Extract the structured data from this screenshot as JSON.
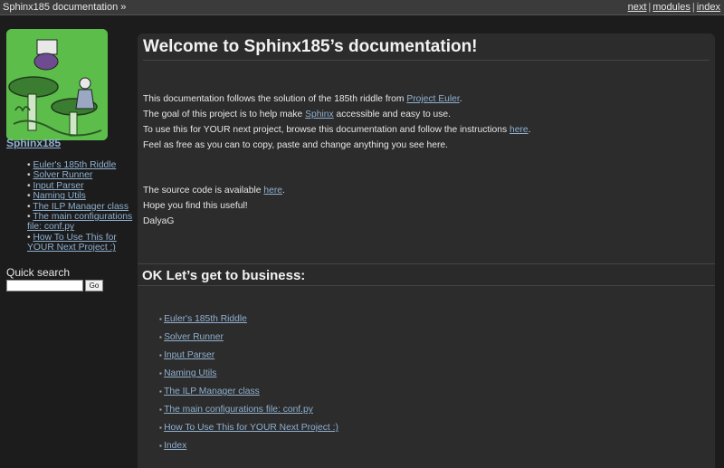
{
  "topbar": {
    "home": "Sphinx185 documentation",
    "raquo": "»",
    "links": [
      "next",
      "modules",
      "index"
    ],
    "separator": "|"
  },
  "sidebar": {
    "project": "Sphinx185",
    "toc": [
      "Euler's 185th Riddle",
      "Solver Runner",
      "Input Parser",
      "Naming Utils",
      "The ILP Manager class",
      "The main configurations file: conf.py",
      "How To Use This for YOUR Next Project :)"
    ],
    "search_title": "Quick search",
    "search_button": "Go"
  },
  "main": {
    "title": "Welcome to Sphinx185’s documentation!",
    "intro": [
      {
        "text": "This documentation follows the solution of the 185th riddle from ",
        "link": "Project Euler",
        "after": "."
      },
      {
        "text": "The goal of this project is to help make ",
        "link": "Sphinx",
        "after": " accessible and easy to use."
      },
      {
        "text": "To use this for YOUR next project, browse this documentation and follow the instructions ",
        "link": "here",
        "after": "."
      },
      {
        "text": "Feel as free as you can to copy, paste and change anything you see here.",
        "link": "",
        "after": ""
      }
    ],
    "source": {
      "text": "The source code is available ",
      "link": "here",
      "after": "."
    },
    "hope": "Hope you find this useful!",
    "author": "DalyaG",
    "section_title": "OK Let’s get to business:",
    "toc": [
      "Euler's 185th Riddle",
      "Solver Runner",
      "Input Parser",
      "Naming Utils",
      "The ILP Manager class",
      "The main configurations file: conf.py",
      "How To Use This for YOUR Next Project :)",
      "Index"
    ]
  },
  "colors": {
    "background": "#1c1c1c",
    "content": "#2c2c2c",
    "link": "#8fb0cf",
    "logo_green": "#58b84a"
  }
}
